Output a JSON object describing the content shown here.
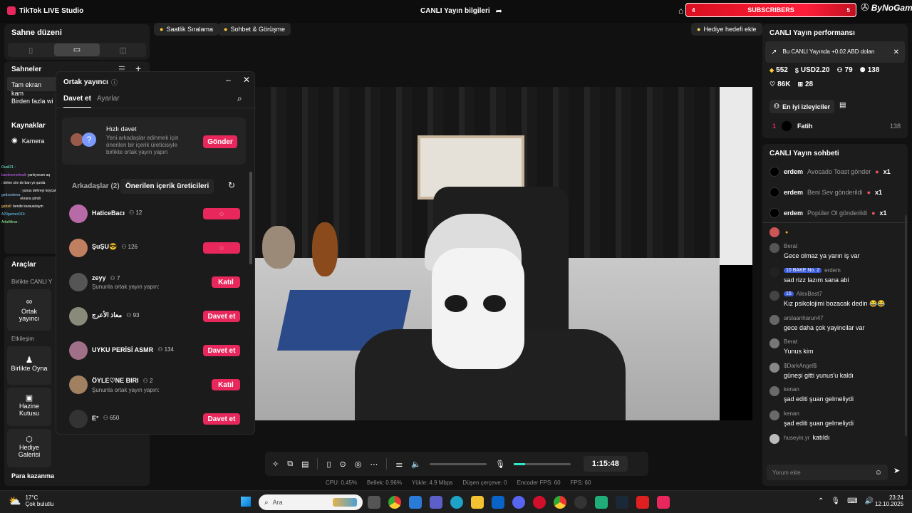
{
  "app": {
    "title": "TikTok LIVE Studio",
    "center_title": "CANLI Yayın bilgileri"
  },
  "subscribers": {
    "left": "4",
    "label": "SUBSCRIBERS",
    "right": "5",
    "brand": "ByNoGame"
  },
  "left": {
    "scene_layout": "Sahne düzeni",
    "scenes": "Sahneler",
    "scene_items": [
      "Tam ekran kam",
      "Birden fazla wi"
    ],
    "sources": "Kaynaklar",
    "camera": "Kamera",
    "tools": "Araçlar",
    "together_live": "Birlikte CANLI Y",
    "tool_cohost": "Ortak yayıncı",
    "interaction": "Etkileşim",
    "tool_play": "Birlikte Oyna",
    "tool_treasure": "Hazine Kutusu",
    "tool_gifts": "Hediye Galerisi",
    "earn": "Para kazanma"
  },
  "overlay_chat": [
    {
      "user": "Ousil21 :",
      "msg": ""
    },
    {
      "user": "bandoomelmali",
      "msg": ": yanlıyorum aq"
    },
    {
      "user": "",
      "msg": ": birine söv de ban ye şurda"
    },
    {
      "user": "gedsonbora",
      "msg": ": yunus dehreyi koycak ekrana şimdi"
    },
    {
      "user": "gattall",
      "msg": ": bende karausdaym"
    },
    {
      "user": "A23games033",
      "msg": ":"
    },
    {
      "user": "ArtizMinar :",
      "msg": ""
    }
  ],
  "top_chips": {
    "ranking": "Saatlik Sıralama",
    "chat": "Sohbet & Görüşme",
    "gift_goal": "Hediye hedefi ekle"
  },
  "cohost": {
    "title": "Ortak yayıncı",
    "tab_invite": "Davet et",
    "tab_settings": "Ayarlar",
    "quick_title": "Hızlı davet",
    "quick_desc": "Yeni arkadaşlar edinmek için önerilen bir içerik üreticisiyle birlikte ortak yayın yapın",
    "send": "Gönder",
    "friends_tab": "Arkadaşlar (2)",
    "suggested_tab": "Önerilen içerik üreticileri",
    "list": [
      {
        "name": "HaticeBacı",
        "count": "12",
        "sub": "",
        "btn": "",
        "color": "#b86aa8"
      },
      {
        "name": "ŞuŞU😎",
        "count": "126",
        "sub": "",
        "btn": "",
        "color": "#c08060"
      },
      {
        "name": "zeyy",
        "count": "7",
        "sub": "Şununla ortak yayın yapın:",
        "btn": "Katıl",
        "color": "#555"
      },
      {
        "name": "معاذ الأعرج",
        "count": "93",
        "sub": "",
        "btn": "Davet et",
        "color": "#8a8a7a"
      },
      {
        "name": "UYKU PERİSİ ASMR",
        "count": "134",
        "sub": "",
        "btn": "Davet et",
        "color": "#a07088"
      },
      {
        "name": "ÖYLE♡NE BIRI",
        "count": "2",
        "sub": "Şununla ortak yayın yapın:",
        "btn": "Katıl",
        "color": "#a08060"
      },
      {
        "name": "E°",
        "count": "650",
        "sub": "",
        "btn": "Davet et",
        "color": "#333"
      }
    ]
  },
  "controls": {
    "timer": "15:48"
  },
  "stats": {
    "cpu": "CPU:  0.45%",
    "memory": "Bellek:  0.96%",
    "upload": "Yükle:  4.9 Mbps",
    "dropped": "Düşen çerçeve:  0",
    "encoder_fps": "Encoder FPS:  60",
    "fps": "FPS:  60"
  },
  "right": {
    "perf_title": "CANLI Yayın performansı",
    "notice": "Bu CANLI Yayında +0.02 ABD doları",
    "diamonds": "552",
    "usd": "USD2.20",
    "viewers": "79",
    "followers": "138",
    "likes": "86K",
    "gifts": "28",
    "top_viewers": "En iyi izleyiciler",
    "top_rank": "1",
    "top_name": "Fatih",
    "top_score": "138",
    "chat_title": "CANLI Yayın sohbeti",
    "gift_msgs": [
      {
        "user": "erdem",
        "text": "Avocado Toast gönder",
        "count": "x1"
      },
      {
        "user": "erdem",
        "text": "Beni Sev gönderildi",
        "count": "x1"
      },
      {
        "user": "erdem",
        "text": "Popüler Ol gönderildi",
        "count": "x1"
      }
    ],
    "chat": [
      {
        "user": "Berat",
        "badges": "",
        "text": "Gece olmaz ya yarın iş var"
      },
      {
        "user": "erdem",
        "badges": "10 BAKE No. 2",
        "text": "sad rizz lazım sana abi"
      },
      {
        "user": "AlexBest7",
        "badges": "15",
        "text": "Kız psikolojimi bozacak dedin 😂😂"
      },
      {
        "user": "arslaanharun47",
        "badges": "",
        "text": "gece daha çok yayincilar var"
      },
      {
        "user": "Berat",
        "badges": "",
        "text": "Yunus kim"
      },
      {
        "user": "$DarkAngel$",
        "badges": "",
        "text": "güneşi gitti yunus'u kaldı"
      },
      {
        "user": "kenan",
        "badges": "",
        "text": "şad editi şuan gelmeliydi"
      },
      {
        "user": "kenan",
        "badges": "",
        "text": "şad editi şuan gelmeliydi"
      },
      {
        "user": "huseyin.yr",
        "badges": "",
        "text": "katıldı"
      }
    ],
    "comment_placeholder": "Yorum ekle"
  },
  "taskbar": {
    "temp": "17°C",
    "weather": "Çok bulutlu",
    "search": "Ara",
    "time": "23:24",
    "date": "12.10.2025"
  }
}
